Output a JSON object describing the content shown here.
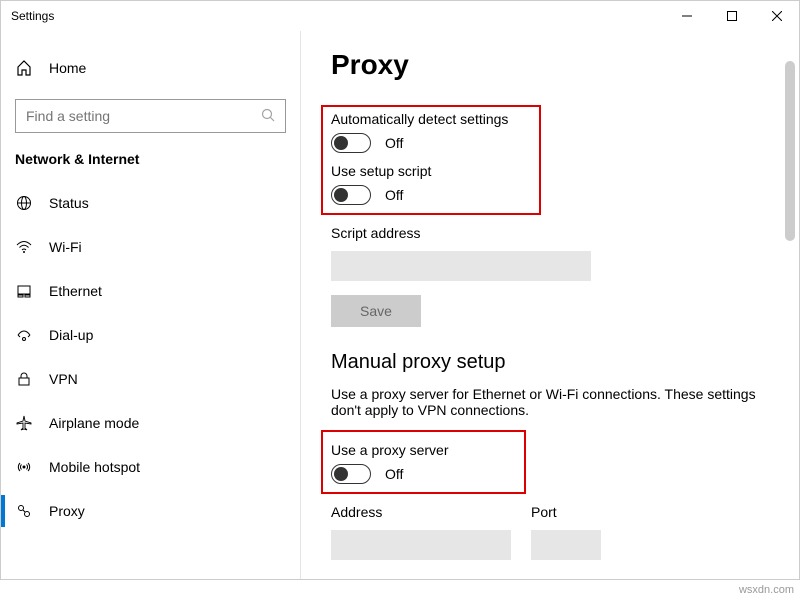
{
  "window": {
    "title": "Settings"
  },
  "sidebar": {
    "home": "Home",
    "search_placeholder": "Find a setting",
    "section": "Network & Internet",
    "items": [
      {
        "label": "Status"
      },
      {
        "label": "Wi-Fi"
      },
      {
        "label": "Ethernet"
      },
      {
        "label": "Dial-up"
      },
      {
        "label": "VPN"
      },
      {
        "label": "Airplane mode"
      },
      {
        "label": "Mobile hotspot"
      },
      {
        "label": "Proxy"
      }
    ]
  },
  "page": {
    "title": "Proxy",
    "auto": {
      "detect_label": "Automatically detect settings",
      "detect_state": "Off",
      "script_label": "Use setup script",
      "script_state": "Off",
      "script_addr_label": "Script address",
      "save": "Save"
    },
    "manual": {
      "heading": "Manual proxy setup",
      "desc": "Use a proxy server for Ethernet or Wi-Fi connections. These settings don't apply to VPN connections.",
      "use_proxy_label": "Use a proxy server",
      "use_proxy_state": "Off",
      "address_label": "Address",
      "port_label": "Port"
    }
  },
  "watermark": "wsxdn.com"
}
